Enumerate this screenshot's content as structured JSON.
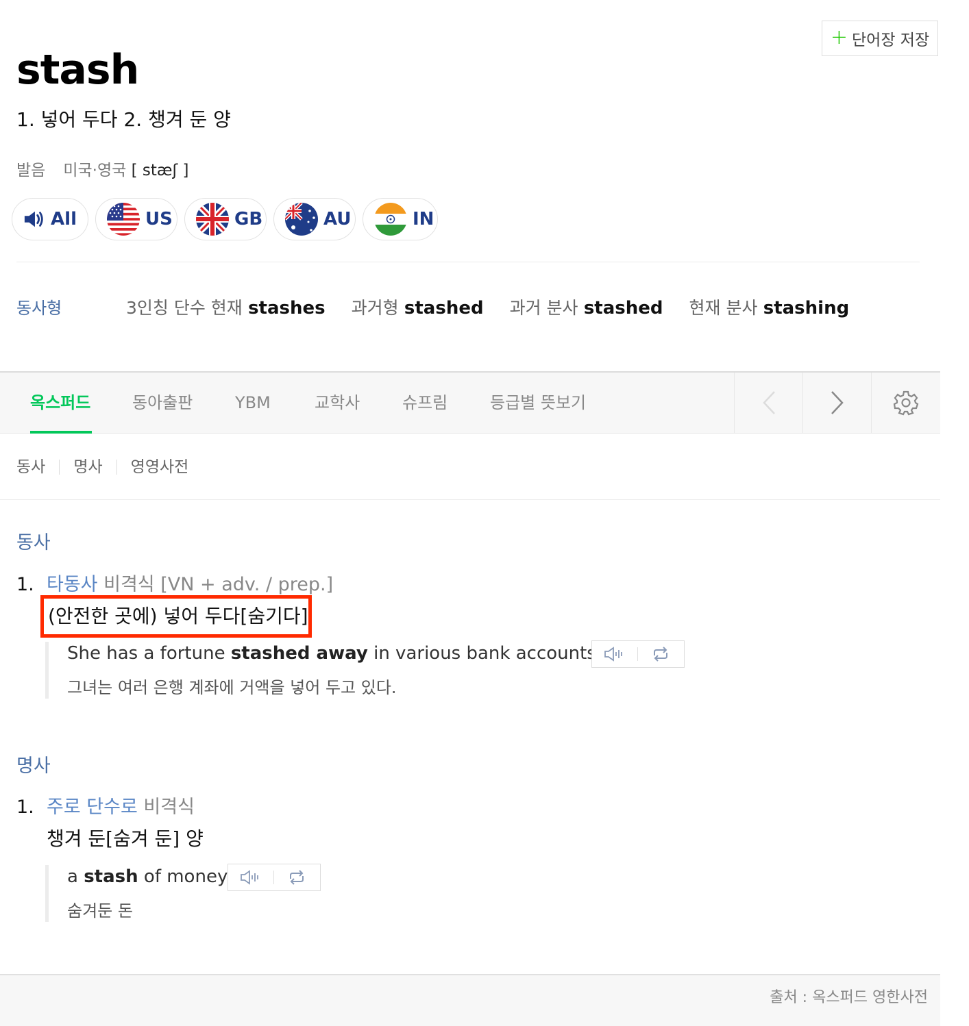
{
  "header": {
    "save_button_label": "단어장 저장",
    "word": "stash",
    "summary": "1. 넣어 두다  2. 챙겨 둔 양"
  },
  "pronunciation": {
    "label": "발음",
    "region": "미국·영국",
    "ipa": "[ stæʃ ]",
    "buttons": [
      {
        "label": "All",
        "icon": "speaker-icon"
      },
      {
        "label": "US",
        "icon": "us-flag-icon"
      },
      {
        "label": "GB",
        "icon": "gb-flag-icon"
      },
      {
        "label": "AU",
        "icon": "au-flag-icon"
      },
      {
        "label": "IN",
        "icon": "in-flag-icon"
      }
    ]
  },
  "conjugation": {
    "label": "동사형",
    "forms": [
      {
        "label": "3인칭 단수 현재",
        "value": "stashes"
      },
      {
        "label": "과거형",
        "value": "stashed"
      },
      {
        "label": "과거 분사",
        "value": "stashed"
      },
      {
        "label": "현재 분사",
        "value": "stashing"
      }
    ]
  },
  "tabs": {
    "items": [
      "옥스퍼드",
      "동아출판",
      "YBM",
      "교학사",
      "슈프림",
      "등급별 뜻보기"
    ],
    "active": "옥스퍼드",
    "controls": [
      "chevron-left-icon",
      "chevron-right-icon",
      "gear-icon"
    ]
  },
  "subtabs": [
    "동사",
    "명사",
    "영영사전"
  ],
  "entries": {
    "verb": {
      "pos": "동사",
      "number": "1.",
      "gram_blue": "타동사",
      "gram_gray": "비격식 [VN + adv. / prep.]",
      "meaning": "(안전한 곳에) 넣어 두다[숨기다]",
      "example": {
        "pre": "She has a fortune ",
        "bold": "stashed away",
        "post": " in various bank accounts.",
        "ko": "그녀는 여러 은행 계좌에 거액을 넣어 두고 있다."
      }
    },
    "noun": {
      "pos": "명사",
      "number": "1.",
      "gram_blue": "주로 단수로",
      "gram_gray": "비격식",
      "meaning": "챙겨 둔[숨겨 둔] 양",
      "example": {
        "pre": "a ",
        "bold": "stash",
        "post": " of money",
        "ko": "숨겨둔 돈"
      }
    }
  },
  "footer": {
    "source": "출처 : 옥스퍼드 영한사전"
  },
  "colors": {
    "accent_green": "#03c75a",
    "link_blue": "#4a6fa5",
    "highlight_red": "#ff2a00"
  }
}
